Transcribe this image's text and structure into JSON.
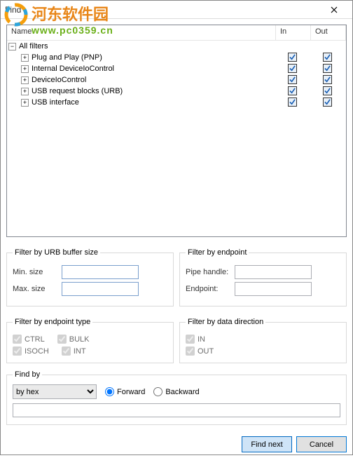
{
  "window": {
    "title": "Find"
  },
  "watermark": {
    "text": "河东软件园",
    "url": "www.pc0359.cn"
  },
  "tree": {
    "headers": {
      "name": "Name",
      "in": "In",
      "out": "Out"
    },
    "root": {
      "label": "All filters"
    },
    "items": [
      {
        "label": "Plug and Play (PNP)"
      },
      {
        "label": "Internal DeviceIoControl"
      },
      {
        "label": "DeviceIoControl"
      },
      {
        "label": "USB request blocks (URB)"
      },
      {
        "label": "USB interface"
      }
    ]
  },
  "filter_urb": {
    "legend": "Filter by URB buffer size",
    "min_label": "Min. size",
    "max_label": "Max. size",
    "min": "",
    "max": ""
  },
  "filter_endpoint": {
    "legend": "Filter by endpoint",
    "pipe_label": "Pipe handle:",
    "ep_label": "Endpoint:",
    "pipe": "",
    "ep": ""
  },
  "filter_eptype": {
    "legend": "Filter by endpoint type",
    "ctrl": "CTRL",
    "bulk": "BULK",
    "isoch": "ISOCH",
    "intr": "INT"
  },
  "filter_dir": {
    "legend": "Filter by data direction",
    "in": "IN",
    "out": "OUT"
  },
  "findby": {
    "legend": "Find by",
    "mode": "by hex",
    "forward": "Forward",
    "backward": "Backward",
    "value": ""
  },
  "buttons": {
    "findnext": "Find next",
    "cancel": "Cancel"
  }
}
